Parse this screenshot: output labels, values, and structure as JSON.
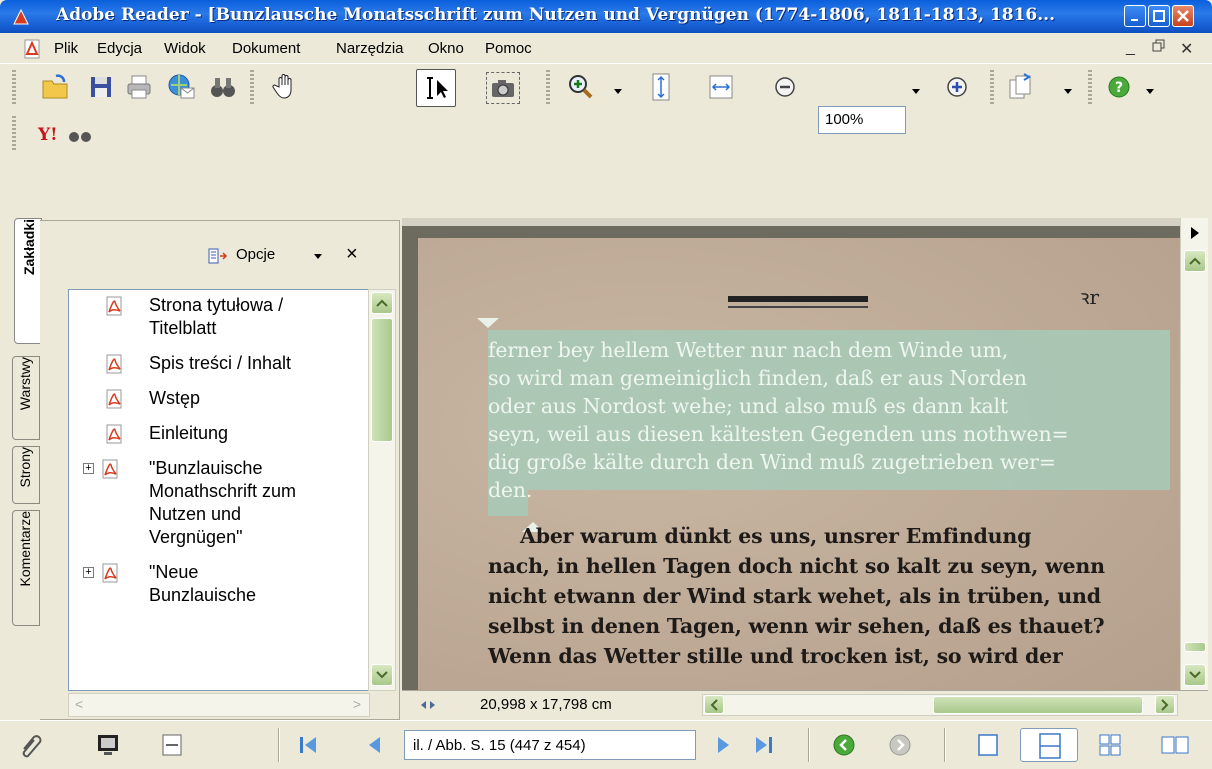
{
  "window": {
    "title": "Adobe Reader - [Bunzlausche Monatsschrift zum Nutzen und Vergnügen (1774-1806, 1811-1813, 1816...",
    "accent": "#1b64d8"
  },
  "menu": {
    "items": [
      "Plik",
      "Edycja",
      "Widok",
      "Dokument",
      "Narzędzia",
      "Okno",
      "Pomoc"
    ]
  },
  "toolbar": {
    "zoom": "100%"
  },
  "panel": {
    "tabs": [
      "Zakładki",
      "Warstwy",
      "Strony",
      "Komentarze"
    ],
    "options_label": "Opcje",
    "close": "×",
    "bookmarks": [
      {
        "lines": [
          "Strona tytułowa /",
          "Titelblatt"
        ],
        "expandable": false
      },
      {
        "lines": [
          "Spis treści / Inhalt"
        ],
        "expandable": false
      },
      {
        "lines": [
          "Wstęp"
        ],
        "expandable": false
      },
      {
        "lines": [
          "Einleitung"
        ],
        "expandable": false
      },
      {
        "lines": [
          "\"Bunzlauische",
          "Monathschrift zum",
          "Nutzen und",
          "Vergnügen\""
        ],
        "expandable": true
      },
      {
        "lines": [
          "\"Neue",
          "Bunzlauische"
        ],
        "expandable": true
      }
    ]
  },
  "document": {
    "corner_mark": "ꝛr",
    "selected_lines": [
      "ferner bey hellem Wetter nur nach dem Winde um,",
      "so wird man gemeiniglich finden, daß er aus Norden",
      "oder aus Nordost wehe; und also muß es dann kalt",
      "seyn, weil aus diesen kältesten Gegenden uns nothwen=",
      "dig große kälte durch den Wind muß zugetrieben wer=",
      "den."
    ],
    "body_lines": [
      "Aber warum dünkt es uns, unsrer Emfindung",
      "nach, in hellen Tagen doch nicht so kalt zu seyn, wenn",
      "nicht etwann der Wind stark wehet, als in trüben, und",
      "selbst in denen Tagen, wenn wir sehen, daß es thauet?",
      "Wenn das Wetter stille und trocken ist, so wird der"
    ],
    "dimensions": "20,998 x 17,798 cm"
  },
  "navigation": {
    "page_field": "il. / Abb. S. 15  (447 z 454)"
  }
}
